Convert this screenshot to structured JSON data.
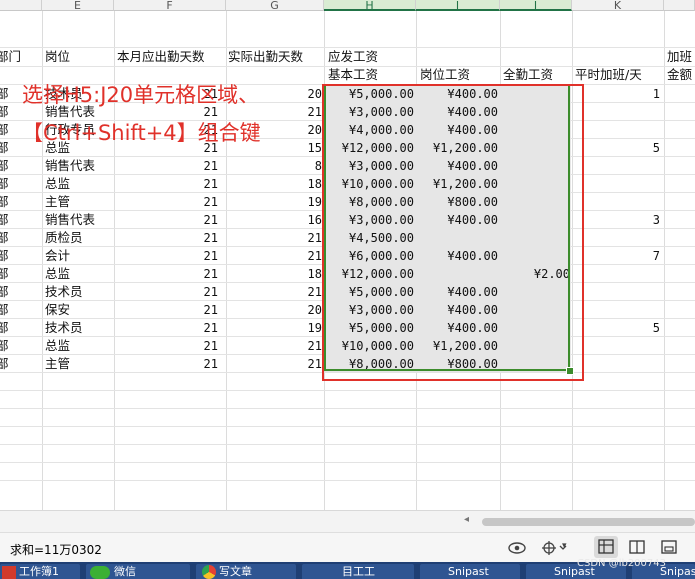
{
  "columns": [
    "E",
    "F",
    "G",
    "H",
    "I",
    "J",
    "K"
  ],
  "headers": {
    "dept": "部门",
    "post": "岗位",
    "plan_days": "本月应出勤天数",
    "actual_days": "实际出勤天数",
    "pay_group": "应发工资",
    "base": "基本工资",
    "post_pay": "岗位工资",
    "full_att": "全勤工资",
    "ot": "平时加班/天",
    "ot2a": "加班",
    "ot2b": "金额"
  },
  "rows": [
    {
      "dept": "部",
      "post": "技术员",
      "plan": "21",
      "actual": "20",
      "base": "¥5,000.00",
      "post_pay": "¥400.00",
      "full": "",
      "ot": "1"
    },
    {
      "dept": "部",
      "post": "销售代表",
      "plan": "21",
      "actual": "21",
      "base": "¥3,000.00",
      "post_pay": "¥400.00",
      "full": "",
      "ot": ""
    },
    {
      "dept": "部",
      "post": "行政专员",
      "plan": "21",
      "actual": "20",
      "base": "¥4,000.00",
      "post_pay": "¥400.00",
      "full": "",
      "ot": ""
    },
    {
      "dept": "部",
      "post": "总监",
      "plan": "21",
      "actual": "15",
      "base": "¥12,000.00",
      "post_pay": "¥1,200.00",
      "full": "",
      "ot": "5"
    },
    {
      "dept": "部",
      "post": "销售代表",
      "plan": "21",
      "actual": "8",
      "base": "¥3,000.00",
      "post_pay": "¥400.00",
      "full": "",
      "ot": ""
    },
    {
      "dept": "部",
      "post": "总监",
      "plan": "21",
      "actual": "18",
      "base": "¥10,000.00",
      "post_pay": "¥1,200.00",
      "full": "",
      "ot": ""
    },
    {
      "dept": "部",
      "post": "主管",
      "plan": "21",
      "actual": "19",
      "base": "¥8,000.00",
      "post_pay": "¥800.00",
      "full": "",
      "ot": ""
    },
    {
      "dept": "部",
      "post": "销售代表",
      "plan": "21",
      "actual": "16",
      "base": "¥3,000.00",
      "post_pay": "¥400.00",
      "full": "",
      "ot": "3"
    },
    {
      "dept": "部",
      "post": "质检员",
      "plan": "21",
      "actual": "21",
      "base": "¥4,500.00",
      "post_pay": "",
      "full": "",
      "ot": ""
    },
    {
      "dept": "部",
      "post": "会计",
      "plan": "21",
      "actual": "21",
      "base": "¥6,000.00",
      "post_pay": "¥400.00",
      "full": "",
      "ot": "7"
    },
    {
      "dept": "部",
      "post": "总监",
      "plan": "21",
      "actual": "18",
      "base": "¥12,000.00",
      "post_pay": "",
      "full": "¥2.00",
      "ot": ""
    },
    {
      "dept": "部",
      "post": "技术员",
      "plan": "21",
      "actual": "21",
      "base": "¥5,000.00",
      "post_pay": "¥400.00",
      "full": "",
      "ot": ""
    },
    {
      "dept": "部",
      "post": "保安",
      "plan": "21",
      "actual": "20",
      "base": "¥3,000.00",
      "post_pay": "¥400.00",
      "full": "",
      "ot": ""
    },
    {
      "dept": "部",
      "post": "技术员",
      "plan": "21",
      "actual": "19",
      "base": "¥5,000.00",
      "post_pay": "¥400.00",
      "full": "",
      "ot": "5"
    },
    {
      "dept": "部",
      "post": "总监",
      "plan": "21",
      "actual": "21",
      "base": "¥10,000.00",
      "post_pay": "¥1,200.00",
      "full": "",
      "ot": ""
    },
    {
      "dept": "部",
      "post": "主管",
      "plan": "21",
      "actual": "21",
      "base": "¥8,000.00",
      "post_pay": "¥800.00",
      "full": "",
      "ot": ""
    }
  ],
  "annotation": {
    "line1": "选择H5:J20单元格区域、",
    "line2": "【Ctrl+Shift+4】组合键"
  },
  "status": {
    "sum": "求和=11万0302"
  },
  "taskbar": {
    "items": [
      "工作簿1",
      "微信",
      "写文章",
      "目工工",
      "Snipast",
      "Snipast",
      "Snipast"
    ],
    "watermark": "CSDN @lb200743"
  },
  "colors": {
    "accent_green": "#217346",
    "annotation_red": "#e0312a",
    "selection_border": "#3c8c2c"
  }
}
